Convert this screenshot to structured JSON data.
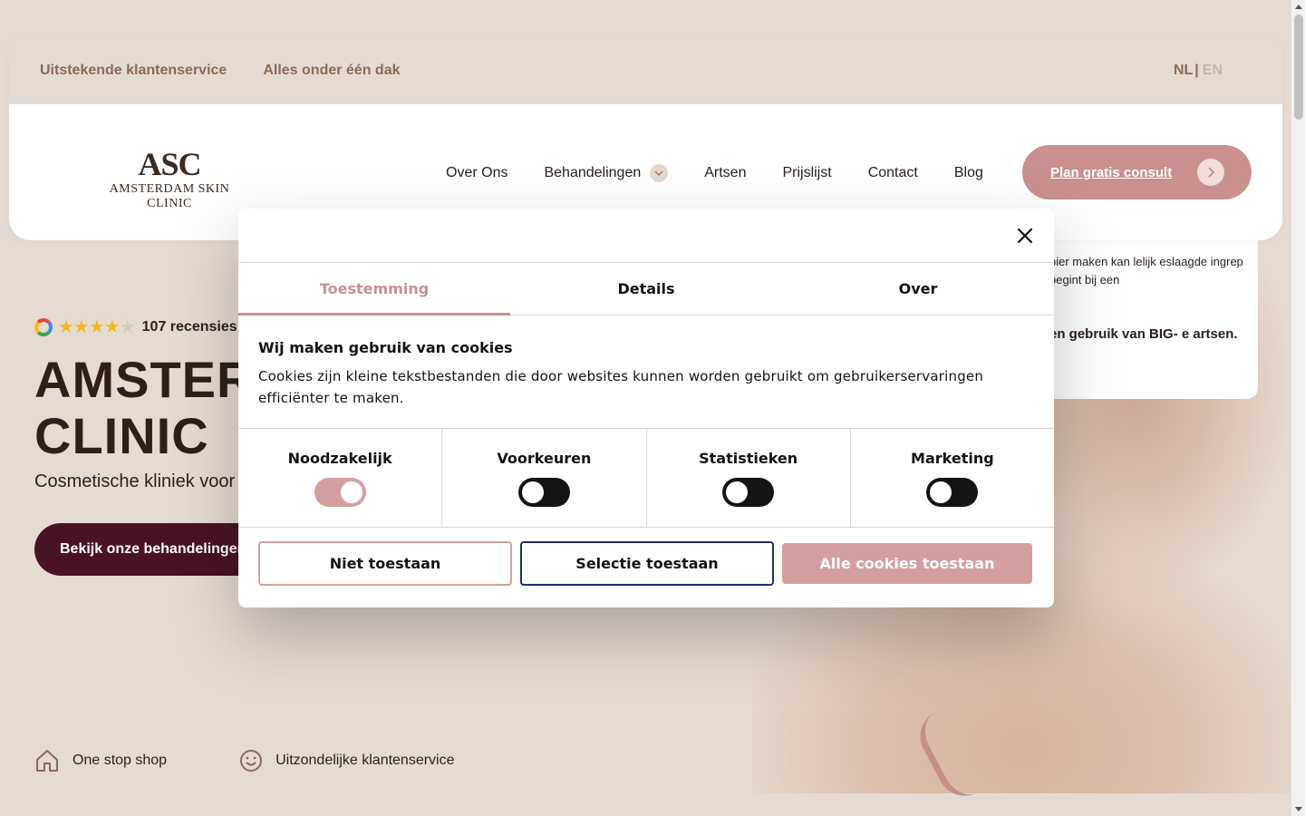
{
  "topbar": {
    "usps": [
      "Uitstekende klantenservice",
      "Alles onder één dak"
    ],
    "lang_nl": "NL",
    "lang_sep": "|",
    "lang_en": "EN"
  },
  "logo": {
    "mark": "ASC",
    "name": "AMSTERDAM SKIN CLINIC"
  },
  "nav": {
    "items": [
      "Over Ons",
      "Behandelingen",
      "Artsen",
      "Prijslijst",
      "Contact",
      "Blog"
    ],
    "cta": "Plan gratis consult"
  },
  "hero": {
    "rating_count": "107 recensies",
    "rating_value": 4.5,
    "title_line1": "AMSTERD",
    "title_line2": "CLINIC",
    "subtitle": "Cosmetische kliniek voor i",
    "button": "Bekijk onze behandelingen",
    "usps": [
      "One stop shop",
      "Uitzondelijke klantenservice"
    ]
  },
  "info_card": {
    "p1": "pier maken kan lelijk eslaagde ingrep begint bij een",
    "p2": "en gebruik van BIG- e artsen."
  },
  "cookie": {
    "tabs": [
      "Toestemming",
      "Details",
      "Over"
    ],
    "heading": "Wij maken gebruik van cookies",
    "text": "Cookies zijn kleine tekstbestanden die door websites kunnen worden gebruikt om gebruikerservaringen efficiënter te maken.",
    "toggles": [
      {
        "label": "Noodzakelijk",
        "on": true
      },
      {
        "label": "Voorkeuren",
        "on": false
      },
      {
        "label": "Statistieken",
        "on": false
      },
      {
        "label": "Marketing",
        "on": false
      }
    ],
    "buttons": {
      "deny": "Niet toestaan",
      "selection": "Selectie toestaan",
      "all": "Alle cookies toestaan"
    }
  },
  "colors": {
    "accent": "#c9908f",
    "dark_button": "#4a1325",
    "background": "#e6dbd3"
  }
}
